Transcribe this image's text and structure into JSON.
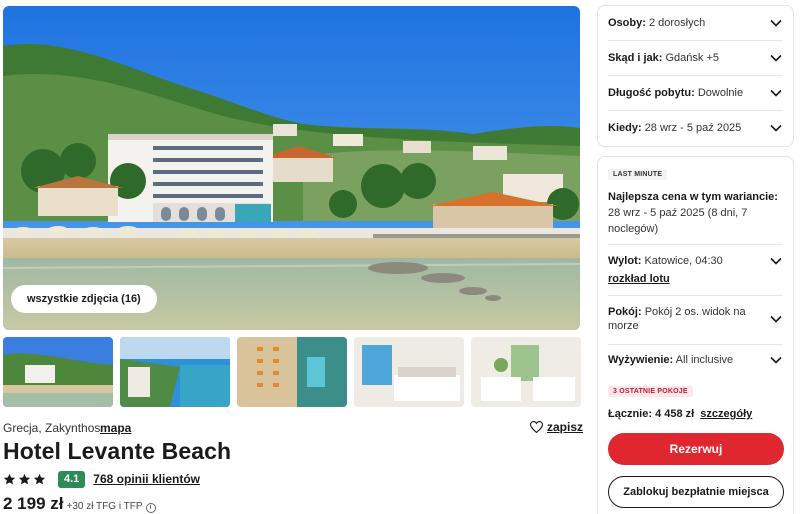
{
  "gallery": {
    "all_photos_label": "wszystkie zdjęcia (16)",
    "thumbnail_count": 5
  },
  "hotel": {
    "location": "Grecja, Zakynthos",
    "map_label": "mapa",
    "save_label": "zapisz",
    "name": "Hotel Levante Beach",
    "stars": 3,
    "score": "4.1",
    "score_color": "#2e8b57",
    "reviews_label": "768 opinii klientów",
    "price": "2 199 zł",
    "price_extra": "+30 zł TFG i TFP",
    "info_icon": "ⓘ"
  },
  "search_options": [
    {
      "label": "Osoby:",
      "value": "2 dorosłych"
    },
    {
      "label": "Skąd i jak:",
      "value": "Gdańsk +5"
    },
    {
      "label": "Długość pobytu:",
      "value": "Dowolnie"
    },
    {
      "label": "Kiedy:",
      "value": "28 wrz - 5 paź 2025"
    }
  ],
  "offer": {
    "tag": "LAST MINUTE",
    "best_price_label": "Najlepsza cena w tym wariancie:",
    "best_price_value": "28 wrz - 5 paź 2025 (8 dni, 7 noclegów)",
    "departure_label": "Wylot:",
    "departure_value": "Katowice, 04:30",
    "flight_schedule_label": "rozkład lotu",
    "room_label": "Pokój:",
    "room_value": "Pokój 2 os. widok na morze",
    "board_label": "Wyżywienie:",
    "board_value": "All inclusive",
    "rooms_left_tag": "3 OSTATNIE POKOJE",
    "total_label": "Łącznie: 4 458 zł",
    "details_label": "szczegóły",
    "reserve_label": "Rezerwuj",
    "block_label": "Zablokuj bezpłatnie miejsca"
  },
  "colors": {
    "accent_red": "#e0262f",
    "rooms_tag_bg": "#fde7ea",
    "rooms_tag_text": "#d0162c"
  }
}
